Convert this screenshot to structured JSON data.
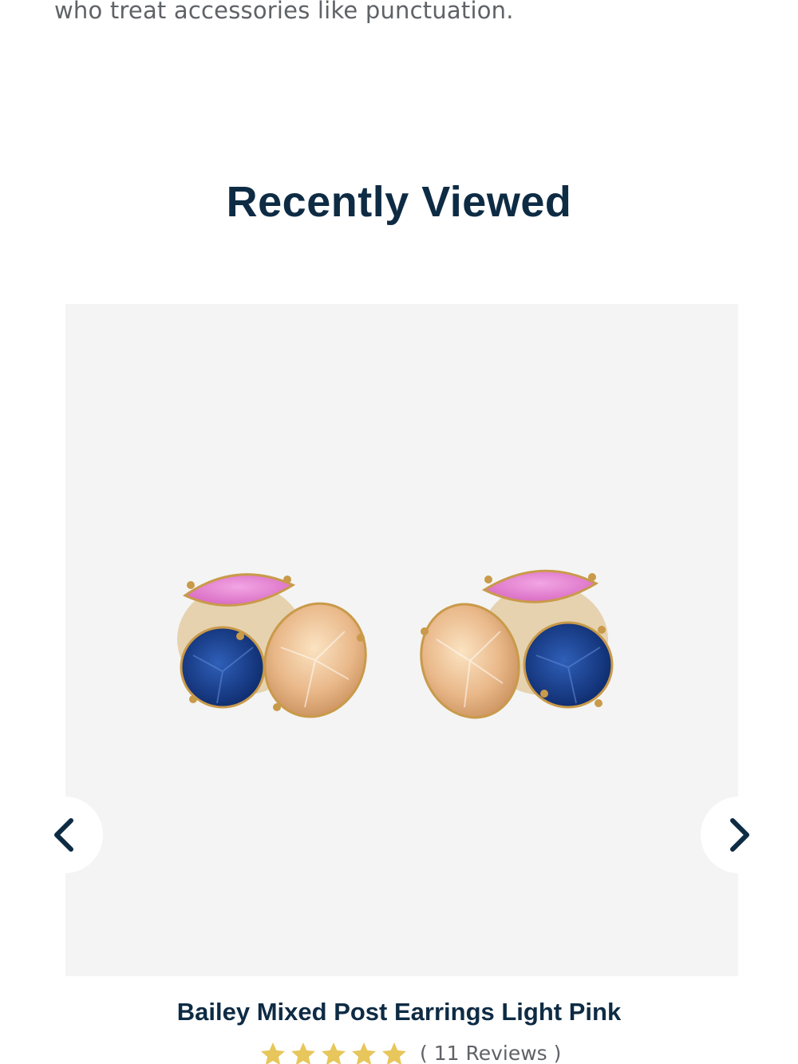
{
  "intro": {
    "text": "who treat accessories like punctuation."
  },
  "recently_viewed": {
    "title": "Recently Viewed",
    "product": {
      "name": "Bailey Mixed Post Earrings Light Pink",
      "rating": 5,
      "reviews_label": "( 11 Reviews )",
      "image_icon": "earrings-image"
    },
    "prev_icon": "chevron-left-icon",
    "next_icon": "chevron-right-icon"
  },
  "colors": {
    "heading": "#0e2b44",
    "body_text": "#5f6266",
    "image_bg": "#f4f4f4",
    "star": "#e7c65b"
  }
}
